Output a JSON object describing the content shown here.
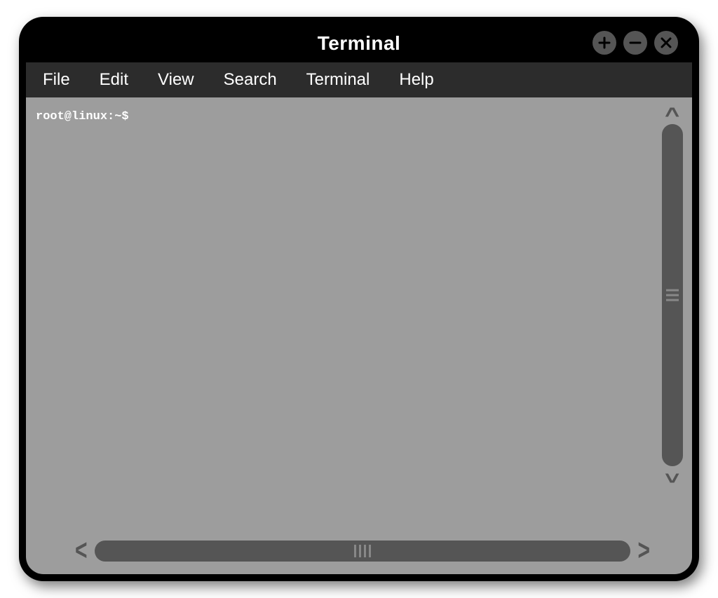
{
  "window": {
    "title": "Terminal"
  },
  "menu": {
    "items": [
      {
        "label": "File"
      },
      {
        "label": "Edit"
      },
      {
        "label": "View"
      },
      {
        "label": "Search"
      },
      {
        "label": "Terminal"
      },
      {
        "label": "Help"
      }
    ]
  },
  "terminal": {
    "prompt": "root@linux:~$"
  }
}
